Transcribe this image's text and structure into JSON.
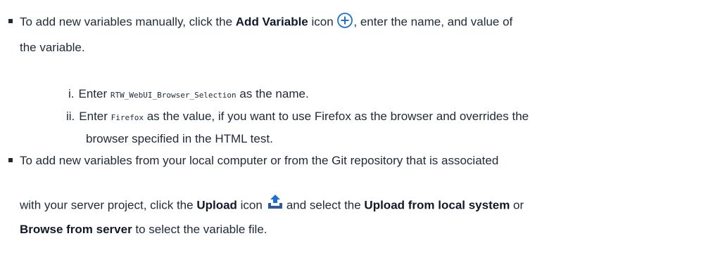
{
  "bullet1": {
    "text_a": "To add new variables manually, click the ",
    "bold_a": "Add Variable",
    "text_b": " icon ",
    "icon": "add-circle-icon",
    "text_c": ", enter the name, and value of",
    "line2": "the variable."
  },
  "steps": [
    {
      "marker": "i.",
      "text_a": "Enter ",
      "code": "RTW_WebUI_Browser_Selection",
      "text_b": " as the name."
    },
    {
      "marker": "ii.",
      "text_a": "Enter ",
      "code": "Firefox",
      "text_b": " as the value, if you want to use Firefox as the browser and overrides the",
      "line2": "browser specified in the HTML test."
    }
  ],
  "bullet2": {
    "line1": "To add new variables from your local computer or from the Git repository that is associated",
    "text_a": "with your server project, click the ",
    "bold_a": "Upload",
    "text_b": " icon",
    "icon": "upload-icon",
    "text_c": "and select the ",
    "bold_b": "Upload from local system",
    "text_d": " or",
    "bold_c": "Browse from server",
    "text_e": " to select the variable file."
  },
  "colors": {
    "text": "#1f2937",
    "icon_blue": "#1f6fd1"
  }
}
